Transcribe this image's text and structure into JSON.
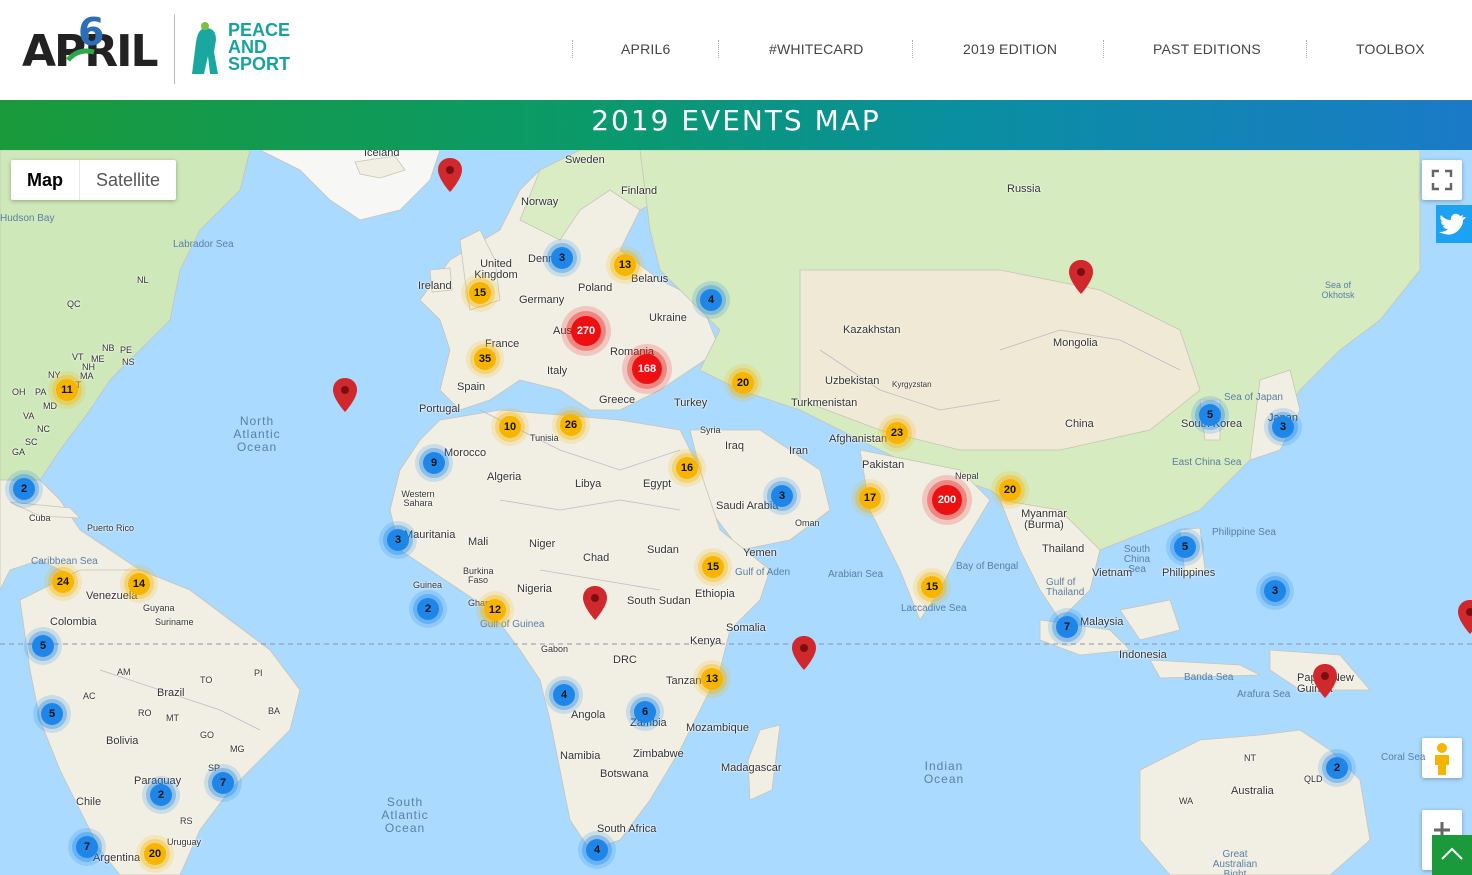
{
  "header": {
    "logo_april": "APRIL",
    "logo_april_six": "6",
    "logo_peace_sport": [
      "PEACE",
      "AND",
      "SPORT"
    ],
    "nav": [
      "APRIL6",
      "#WHITECARD",
      "2019 EDITION",
      "PAST EDITIONS",
      "TOOLBOX"
    ]
  },
  "banner": {
    "title": "2019 EVENTS MAP"
  },
  "map": {
    "map_type": {
      "map_label": "Map",
      "satellite_label": "Satellite",
      "selected": "Map"
    },
    "colors": {
      "water": "#aadaff",
      "land": "#f4f1e6",
      "cluster_small": "#1e86e8",
      "cluster_medium": "#f7b500",
      "cluster_large": "#ee1010",
      "pin": "#d0282c"
    },
    "clusters": [
      "3",
      "13",
      "15",
      "4",
      "270",
      "35",
      "168",
      "20",
      "11",
      "10",
      "26",
      "9",
      "2",
      "16",
      "23",
      "3",
      "17",
      "200",
      "20",
      "5",
      "3",
      "3",
      "24",
      "14",
      "2",
      "12",
      "15",
      "5",
      "15",
      "7",
      "5",
      "3",
      "4",
      "13",
      "6",
      "5",
      "2",
      "7",
      "2",
      "20",
      "7",
      "4"
    ],
    "place_labels": [
      "Iceland",
      "Sweden",
      "Finland",
      "Norway",
      "Russia",
      "United Kingdom",
      "Ireland",
      "Denmark",
      "Belarus",
      "Poland",
      "Germany",
      "Ukraine",
      "France",
      "Austria",
      "Romania",
      "Kazakhstan",
      "Mongolia",
      "Italy",
      "Spain",
      "Portugal",
      "Greece",
      "Turkey",
      "Uzbekistan",
      "Kyrgyzstan",
      "Turkmenistan",
      "Syria",
      "Iraq",
      "Iran",
      "Afghanistan",
      "Pakistan",
      "China",
      "South Korea",
      "Japan",
      "Tunisia",
      "Morocco",
      "Algeria",
      "Libya",
      "Egypt",
      "Saudi Arabia",
      "Oman",
      "Nepal",
      "Western Sahara",
      "Mauritania",
      "Mali",
      "Niger",
      "Chad",
      "Sudan",
      "Yemen",
      "Myanmar (Burma)",
      "Thailand",
      "Vietnam",
      "Philippines",
      "Cuba",
      "Puerto Rico",
      "Venezuela",
      "Guyana",
      "Suriname",
      "Colombia",
      "Guinea",
      "Burkina Faso",
      "Ghana",
      "Nigeria",
      "South Sudan",
      "Ethiopia",
      "Somalia",
      "Kenya",
      "Gabon",
      "DRC",
      "Tanzania",
      "Malaysia",
      "Indonesia",
      "Papua New Guinea",
      "Brazil",
      "Bolivia",
      "Angola",
      "Zambia",
      "Mozambique",
      "Namibia",
      "Zimbabwe",
      "Botswana",
      "Madagascar",
      "Paraguay",
      "Chile",
      "Uruguay",
      "Argentina",
      "South Africa",
      "Australia"
    ],
    "water_labels": [
      "North Atlantic Ocean",
      "South Atlantic Ocean",
      "Indian Ocean",
      "Labrador Sea",
      "Caribbean Sea",
      "Arabian Sea",
      "Bay of Bengal",
      "Laccadive Sea",
      "Gulf of Aden",
      "Gulf of Guinea",
      "Sea of Japan",
      "East China Sea",
      "South China Sea",
      "Philippine Sea",
      "Gulf of Thailand",
      "Banda Sea",
      "Arafura Sea",
      "Coral Sea",
      "Sea of Okhotsk",
      "Great Australian Bight",
      "Hudson Bay"
    ],
    "region_abbrev": [
      "NL",
      "QC",
      "ME",
      "NS",
      "NB",
      "VT",
      "NH",
      "MA",
      "CT",
      "NY",
      "PA",
      "OH",
      "MD",
      "VA",
      "NC",
      "SC",
      "GA",
      "PE",
      "AC",
      "RO",
      "MT",
      "GO",
      "MG",
      "RS",
      "BA",
      "PI",
      "SP",
      "NT",
      "QLD",
      "WA",
      "TO",
      "AM"
    ]
  }
}
